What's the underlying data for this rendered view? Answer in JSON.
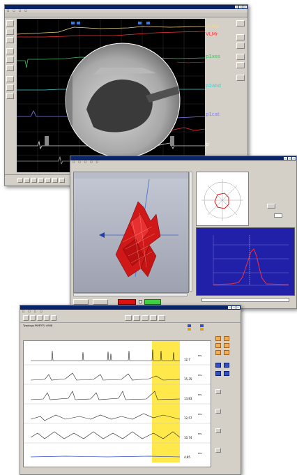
{
  "window1": {
    "channels": [
      {
        "label": "VLMa",
        "color": "#f0d890"
      },
      {
        "label": "VLMr",
        "color": "#ff3333"
      },
      {
        "label": "p1xes",
        "color": "#40c060"
      },
      {
        "label": "p2abd",
        "color": "#40d0d0"
      },
      {
        "label": "p1cat",
        "color": "#8080ff"
      },
      {
        "label": "p",
        "color": "#ffffff"
      }
    ]
  },
  "window3": {
    "header_text": "Typology  PWEYTU  4908",
    "row_values": [
      {
        "unit": "ms",
        "value": "12,7"
      },
      {
        "unit": "ms",
        "value": "15,35"
      },
      {
        "unit": "ms",
        "value": "13,83"
      },
      {
        "unit": "ms",
        "value": "12,57"
      },
      {
        "unit": "ms",
        "value": "10,74"
      },
      {
        "unit": "ms",
        "value": "4,85"
      }
    ]
  }
}
